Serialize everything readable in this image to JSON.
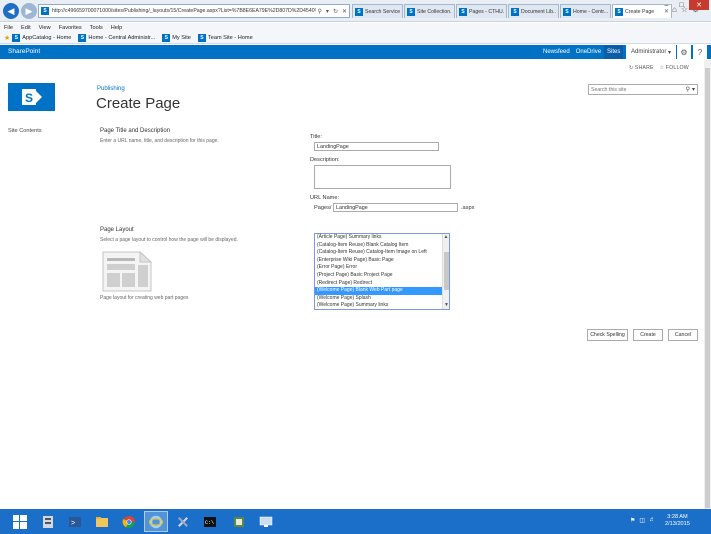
{
  "browser": {
    "url": "http://c496659700071000/sites/Publishing/_layouts/15/CreatePage.aspx?List=%7B8E6EA79E%2D807D%2D4540%2DACE1%2...",
    "tabs": [
      {
        "label": "Search Service ..."
      },
      {
        "label": "Site Collection..."
      },
      {
        "label": "Pages - CTHU..."
      },
      {
        "label": "Document Lib..."
      },
      {
        "label": "Home - Centr..."
      },
      {
        "label": "Create Page",
        "active": true
      }
    ],
    "menu": [
      "File",
      "Edit",
      "View",
      "Favorites",
      "Tools",
      "Help"
    ],
    "favorites": [
      "AppCatalog - Home",
      "Home - Central Administr...",
      "My Site",
      "Team Site - Home"
    ]
  },
  "suite": {
    "brand": "SharePoint",
    "links": [
      "Newsfeed",
      "OneDrive",
      "Sites"
    ],
    "active_link": "Sites",
    "user": "Administrator",
    "share": "SHARE",
    "follow": "FOLLOW"
  },
  "header": {
    "breadcrumb": "Publishing",
    "title": "Create Page",
    "search_placeholder": "Search this site"
  },
  "left_nav": {
    "site_contents": "Site Contents"
  },
  "form": {
    "title_section": {
      "heading": "Page Title and Description",
      "description": "Enter a URL name, title, and description for this page."
    },
    "title_label": "Title:",
    "title_value": "LandingPage",
    "description_label": "Description:",
    "url_label": "URL Name:",
    "url_prefix": "Pages/",
    "url_value": "LandingPage",
    "url_suffix": ".aspx",
    "layout_section": {
      "heading": "Page Layout",
      "description": "Select a page layout to control how the page will be displayed.",
      "caption": "Page layout for creating web part pages"
    },
    "layouts": [
      "(Article Page) Summary links",
      "(Catalog-Item Reuse) Blank Catalog Item",
      "(Catalog-Item Reuse) Catalog-Item Image on Left",
      "(Enterprise Wiki Page) Basic Page",
      "(Error Page) Error",
      "(Project Page) Basic Project Page",
      "(Redirect Page) Redirect",
      "(Welcome Page) Blank Web Part page",
      "(Welcome Page) Splash",
      "(Welcome Page) Summary links"
    ],
    "selected_layout": "(Welcome Page) Blank Web Part page",
    "buttons": {
      "check_spelling": "Check Spelling",
      "create": "Create",
      "cancel": "Cancel"
    }
  },
  "taskbar": {
    "time": "3:28 AM",
    "date": "2/13/2015"
  }
}
